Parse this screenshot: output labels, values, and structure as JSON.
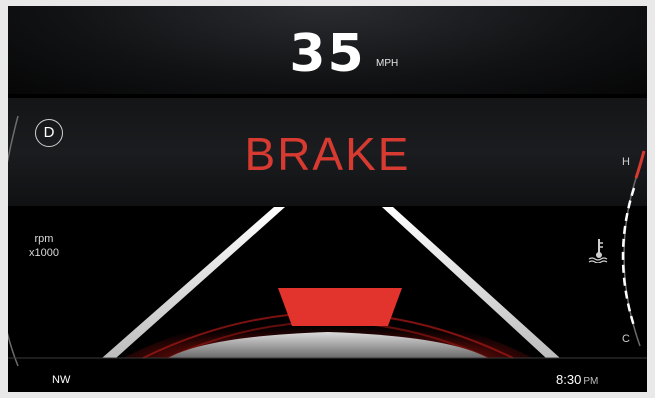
{
  "speed": {
    "value": "35",
    "unit": "MPH"
  },
  "alert": {
    "text": "BRAKE",
    "color": "#d63a31"
  },
  "gear": {
    "selected": "D"
  },
  "tachometer": {
    "label_line1": "rpm",
    "label_line2": "x1000"
  },
  "temperature_gauge": {
    "high_label": "H",
    "low_label": "C",
    "icon": "coolant-temperature-icon"
  },
  "status_bar": {
    "compass": "NW",
    "time": "8:30",
    "ampm": "PM"
  },
  "colors": {
    "background": "#000000",
    "accent_red": "#d63a31",
    "lane_white": "#e8e8e8"
  }
}
